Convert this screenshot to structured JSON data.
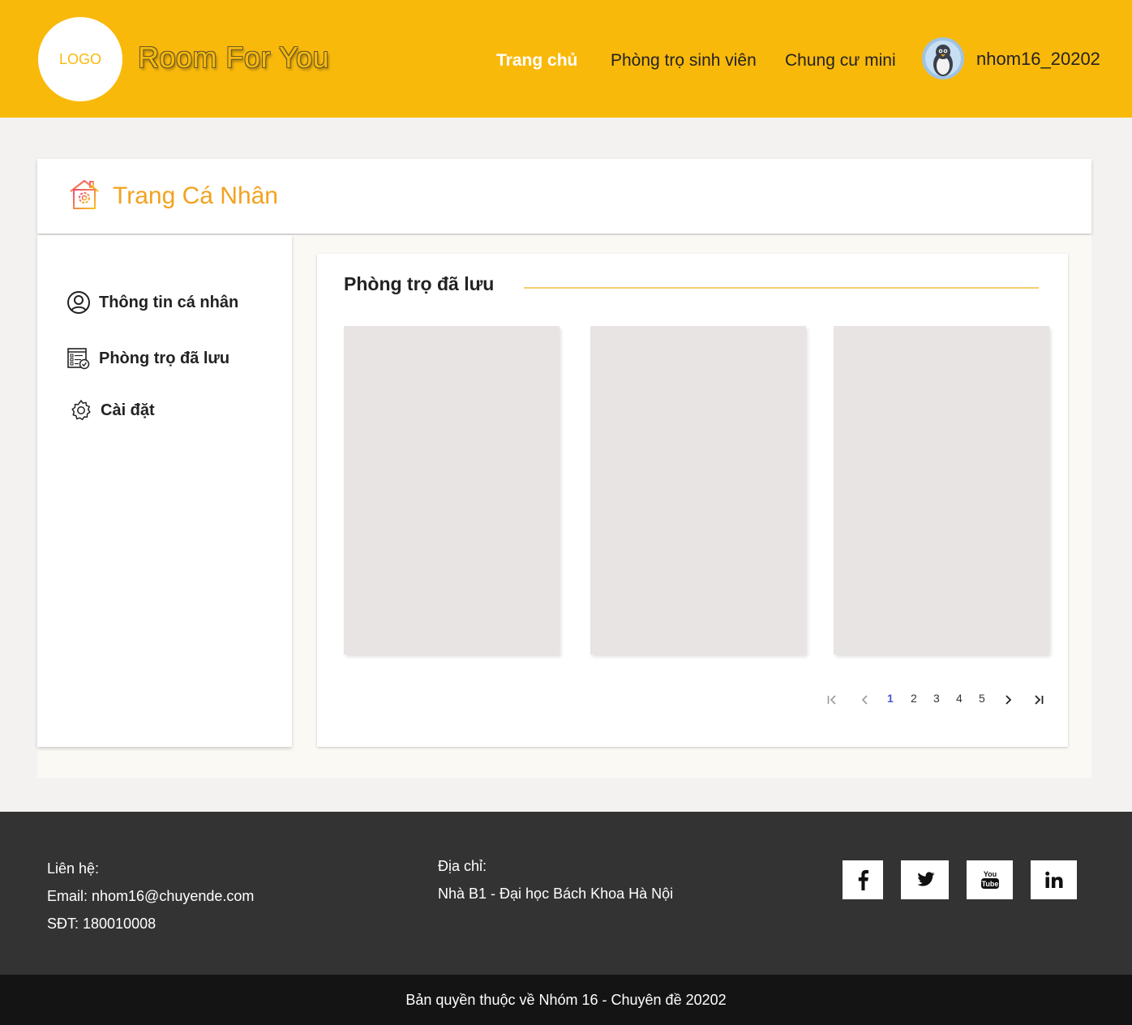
{
  "header": {
    "logo_text": "LOGO",
    "brand": "Room For You",
    "nav": {
      "home": "Trang chủ",
      "student_rooms": "Phòng trọ sinh viên",
      "mini_apartments": "Chung cư mini"
    },
    "username": "nhom16_20202",
    "colors": {
      "background": "#f9b90b",
      "active_link": "#ffffff"
    }
  },
  "profile": {
    "title": "Trang Cá Nhân",
    "title_icon": "house-gear-icon",
    "title_color": "#f3a21f"
  },
  "sidebar": {
    "items": [
      {
        "label": "Thông tin cá nhân",
        "icon": "user-circle-icon"
      },
      {
        "label": "Phòng trọ đã lưu",
        "icon": "saved-list-icon"
      },
      {
        "label": "Cài đặt",
        "icon": "gear-icon"
      }
    ]
  },
  "saved_rooms": {
    "heading": "Phòng trọ đã lưu",
    "card_count_shown": 3,
    "pagination": {
      "first": "first-page-icon",
      "prev": "prev-page-icon",
      "pages": [
        "1",
        "2",
        "3",
        "4",
        "5"
      ],
      "current": "1",
      "next": "next-page-icon",
      "last": "last-page-icon"
    }
  },
  "footer": {
    "contact_label": "Liên hệ:",
    "email": "Email: nhom16@chuyende.com",
    "phone": "SĐT: 180010008",
    "address_label": "Địa chỉ:",
    "address": "Nhà B1 - Đại học Bách Khoa Hà Nội",
    "social": [
      "facebook-icon",
      "twitter-icon",
      "youtube-icon",
      "linkedin-icon"
    ],
    "copyright": "Bản quyền thuộc về Nhóm 16 - Chuyên đề 20202",
    "colors": {
      "footer": "#333333",
      "bottom_bar": "#141414"
    }
  }
}
